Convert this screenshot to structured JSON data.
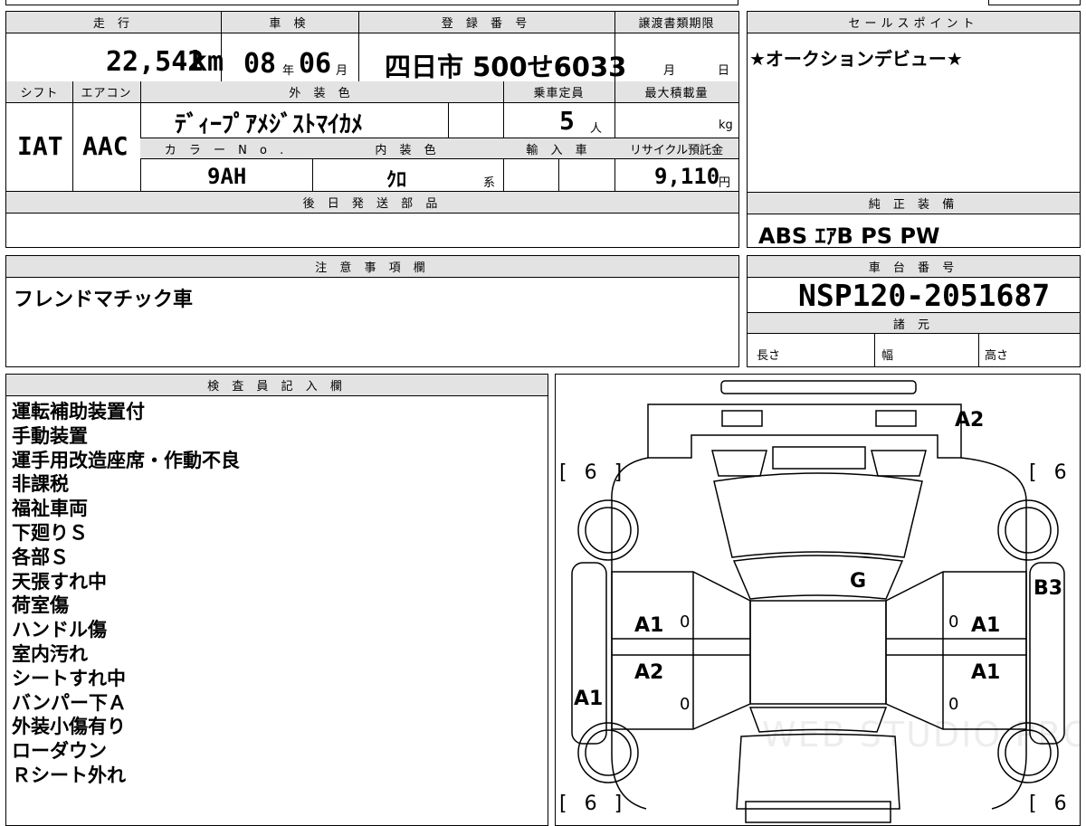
{
  "summary": {
    "mileage_label": "走 行",
    "mileage_value": "22,542",
    "mileage_unit": "km",
    "inspection_label": "車 検",
    "inspection_year": "08",
    "inspection_year_unit": "年",
    "inspection_month": "06",
    "inspection_month_unit": "月",
    "registration_label": "登 録 番 号",
    "registration_value": "四日市 500せ6033",
    "transfer_docs_label": "譲渡書類期限",
    "transfer_month_unit": "月",
    "transfer_day_unit": "日"
  },
  "specs": {
    "shift_label": "シフト",
    "shift_value": "IAT",
    "ac_label": "エアコン",
    "ac_value": "AAC",
    "exterior_color_label": "外 装 色",
    "exterior_color_value": "ﾃﾞｨｰﾌﾟｱﾒｼﾞｽﾄﾏｲｶﾒ",
    "capacity_label": "乗車定員",
    "capacity_value": "5",
    "capacity_unit": "人",
    "max_load_label": "最大積載量",
    "max_load_unit": "kg",
    "color_no_label": "カ ラ ー N o .",
    "color_no_value": "9AH",
    "interior_color_label": "内 装 色",
    "interior_color_value": "ｸﾛ",
    "interior_color_suffix": "系",
    "import_label": "輸 入 車",
    "recycle_label": "リサイクル預託金",
    "recycle_value": "9,110",
    "recycle_unit": "円"
  },
  "later_parts": {
    "label": "後 日 発 送 部 品",
    "value": ""
  },
  "sales_point": {
    "label": "セールスポイント",
    "value": "★オークションデビュー★"
  },
  "equipment": {
    "label": "純 正 装 備",
    "value": "ABS ｴｱB PS PW"
  },
  "notes": {
    "label": "注 意 事 項 欄",
    "value": "フレンドマチック車"
  },
  "chassis": {
    "label": "車 台 番 号",
    "value": "NSP120-2051687"
  },
  "dimensions": {
    "label": "諸 元",
    "length_label": "長さ",
    "width_label": "幅",
    "height_label": "高さ"
  },
  "inspector": {
    "label": "検 査 員 記 入 欄",
    "items": [
      "運転補助装置付",
      "手動装置",
      "運手用改造座席・作動不良",
      "非課税",
      "福祉車両",
      "下廻りＳ",
      "各部Ｓ",
      "天張すれ中",
      "荷室傷",
      "ハンドル傷",
      "室内汚れ",
      "シートすれ中",
      "バンパー下Ａ",
      "外装小傷有り",
      "ローダウン",
      "Ｒシート外れ"
    ]
  },
  "diagram": {
    "marks": {
      "rear_top_right": "A2",
      "tire_top_left": "[ 6 ]",
      "tire_top_right": "[ 6 ]",
      "tire_bottom_left": "[ 6 ]",
      "tire_bottom_right": "[ 6 ]",
      "roof": "G",
      "right_side": "B3",
      "left_rear_door": "A1",
      "left_rear_door_num": "0",
      "right_rear_door": "A1",
      "right_rear_door_num": "0",
      "left_front_door": "A2",
      "left_front_door_num": "0",
      "right_front_door": "A1",
      "right_front_door_num": "0",
      "left_side": "A1"
    },
    "watermark": "WEB STUDIO PRO"
  }
}
